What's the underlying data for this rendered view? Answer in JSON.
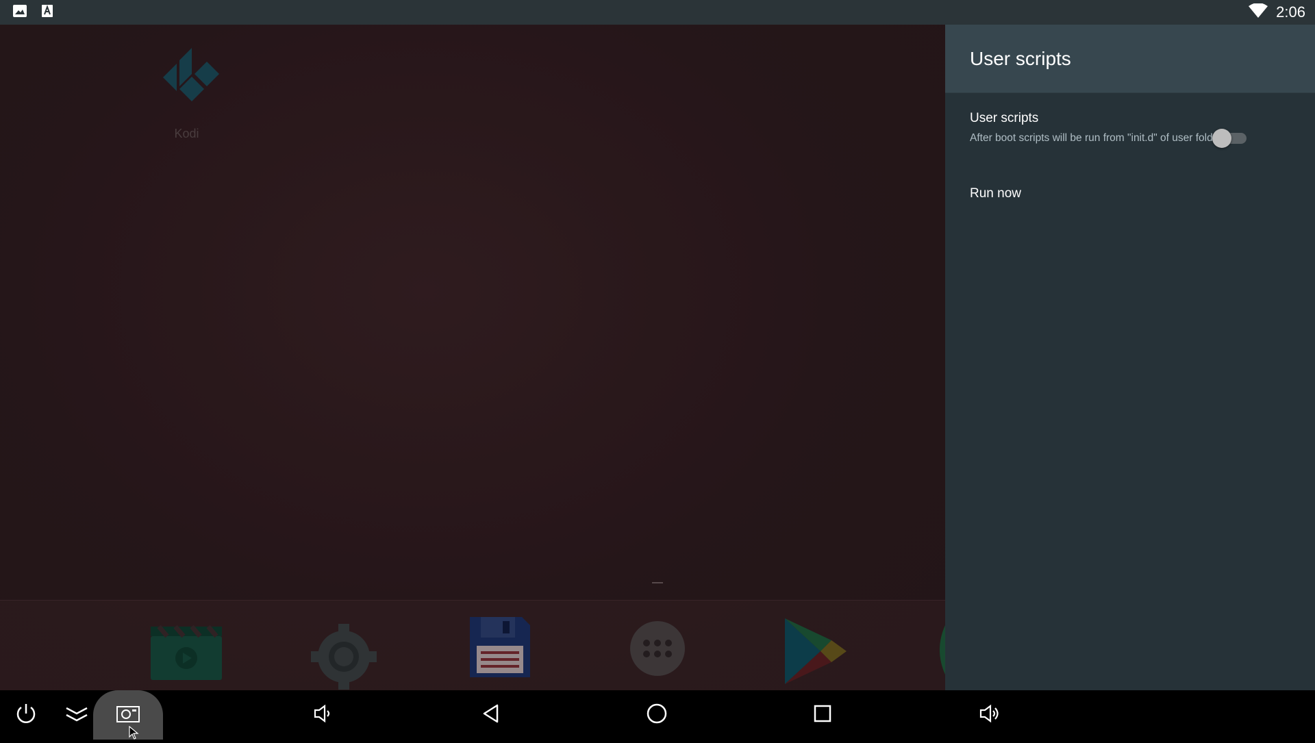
{
  "status_bar": {
    "time": "2:06",
    "icons": [
      "image-icon",
      "text-a-icon",
      "wifi-icon"
    ]
  },
  "launcher": {
    "apps": [
      {
        "label": "Kodi",
        "icon": "kodi-icon"
      }
    ],
    "dock": [
      "video-icon",
      "settings-gear-icon",
      "save-floppy-icon",
      "app-drawer-icon",
      "play-store-icon"
    ]
  },
  "panel": {
    "title": "User scripts",
    "preference": {
      "title": "User scripts",
      "summary": "After boot scripts will be run from \"init.d\" of user folder",
      "enabled": false
    },
    "run_now_label": "Run now"
  },
  "nav_bar": {
    "buttons": [
      "power-icon",
      "collapse-icon",
      "screenshot-icon",
      "volume-down-icon",
      "back-icon",
      "home-icon",
      "recents-icon",
      "volume-up-icon"
    ]
  },
  "colors": {
    "panel_bg": "#263238",
    "panel_header": "#37474f",
    "status_bar": "#2b3438"
  }
}
